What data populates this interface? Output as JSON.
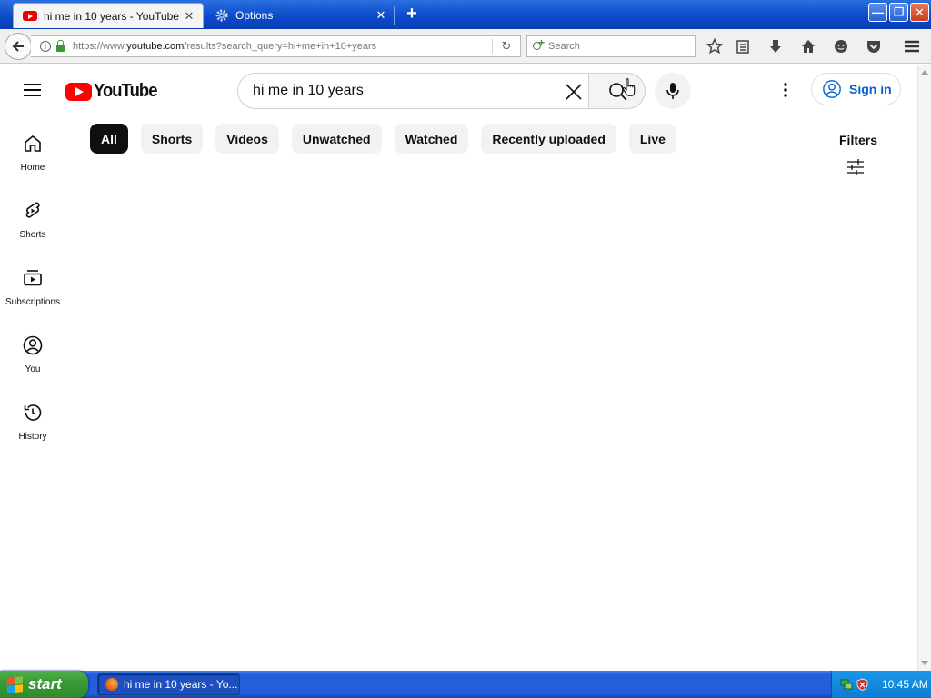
{
  "browser": {
    "tabs": [
      {
        "label": "hi me in 10 years - YouTube",
        "close": "✕"
      },
      {
        "label": "Options",
        "close": "✕"
      }
    ],
    "new_tab": "+",
    "url_prefix": "https://www.",
    "url_domain": "youtube.com",
    "url_rest": "/results?search_query=hi+me+in+10+years",
    "search_placeholder": "Search"
  },
  "youtube": {
    "logo_text": "YouTube",
    "search_value": "hi me in 10 years",
    "sign_in": "Sign in",
    "chips": [
      "All",
      "Shorts",
      "Videos",
      "Unwatched",
      "Watched",
      "Recently uploaded",
      "Live"
    ],
    "selected_chip": "All",
    "filters": "Filters",
    "sidebar": [
      {
        "label": "Home",
        "icon": "home-icon"
      },
      {
        "label": "Shorts",
        "icon": "shorts-icon"
      },
      {
        "label": "Subscriptions",
        "icon": "subscriptions-icon"
      },
      {
        "label": "You",
        "icon": "you-icon"
      },
      {
        "label": "History",
        "icon": "history-icon"
      }
    ],
    "brand_color": "#ff0000",
    "link_color": "#065fd4"
  },
  "taskbar": {
    "start": "start",
    "task": "hi me in 10 years - Yo...",
    "clock": "10:45 AM"
  }
}
